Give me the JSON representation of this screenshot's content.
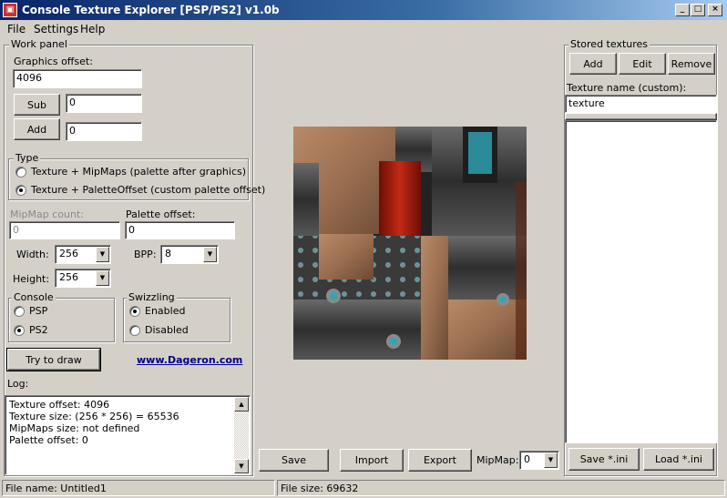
{
  "window": {
    "title": "Console Texture Explorer [PSP/PS2] v1.0b",
    "controls": {
      "minimize": "_",
      "maximize": "□",
      "close": "×"
    }
  },
  "menu": [
    "File",
    "Settings",
    "Help"
  ],
  "work_panel": {
    "title": "Work panel",
    "graphics_offset_label": "Graphics offset:",
    "graphics_offset_value": "4096",
    "sub_button": "Sub",
    "sub_value": "0",
    "add_button": "Add",
    "add_value": "0",
    "type": {
      "title": "Type",
      "options": [
        {
          "label": "Texture + MipMaps (palette after graphics)",
          "checked": false
        },
        {
          "label": "Texture + PaletteOffset (custom palette offset)",
          "checked": true
        }
      ]
    },
    "mipmap_count_label": "MipMap count:",
    "mipmap_count_value": "0",
    "palette_offset_label": "Palette offset:",
    "palette_offset_value": "0",
    "width_label": "Width:",
    "width_value": "256",
    "bpp_label": "BPP:",
    "bpp_value": "8",
    "height_label": "Height:",
    "height_value": "256",
    "console": {
      "title": "Console",
      "options": [
        {
          "label": "PSP",
          "checked": false
        },
        {
          "label": "PS2",
          "checked": true
        }
      ]
    },
    "swizzling": {
      "title": "Swizzling",
      "options": [
        {
          "label": "Enabled",
          "checked": true
        },
        {
          "label": "Disabled",
          "checked": false
        }
      ]
    },
    "try_draw_button": "Try to draw",
    "website_link": "www.Dageron.com",
    "log_label": "Log:",
    "log_lines": [
      "Texture offset: 4096",
      "Texture size: (256 * 256) = 65536",
      "MipMaps size: not defined",
      "Palette offset: 0"
    ]
  },
  "bottom_toolbar": {
    "save": "Save",
    "import": "Import",
    "export": "Export",
    "mipmap_label": "MipMap:",
    "mipmap_value": "0"
  },
  "stored": {
    "title": "Stored textures",
    "add": "Add",
    "edit": "Edit",
    "remove": "Remove",
    "name_label": "Texture name (custom):",
    "name_value": "texture",
    "save_ini": "Save *.ini",
    "load_ini": "Load *.ini"
  },
  "status": {
    "file_name": "File name: Untitled1",
    "file_size": "File size: 69632"
  },
  "colors": {
    "titlebar_start": "#0a246a",
    "titlebar_end": "#a6caf0",
    "face": "#d4d0c8",
    "link": "#00008b",
    "texture_skin": "#a0785a",
    "texture_metal": "#4a4a4a",
    "texture_red": "#9b1b0e",
    "texture_teal": "#2fa6b8"
  }
}
